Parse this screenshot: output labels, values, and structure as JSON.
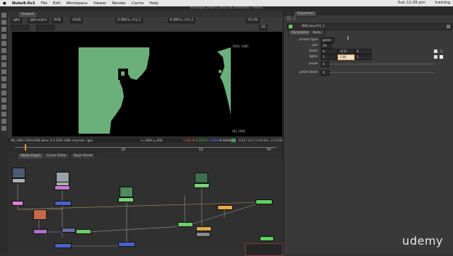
{
  "menubar": {
    "app_name": "Nuke9.0v1",
    "items": [
      "File",
      "Edit",
      "Workspace",
      "Viewer",
      "Render",
      "Cache",
      "Help"
    ],
    "clock": "Sun 11:05 pm",
    "user": "training"
  },
  "window_title": "telescope_shot01_v002.nk [modified] - NukeX",
  "viewer": {
    "tab_label": "Viewer1",
    "channels": "rgba",
    "alpha": "rgba.alpha",
    "display": "RGB",
    "colorspace": "sRGB",
    "input_a": "A  IBKCo..rV3_1",
    "input_b": "B  IBKCo..rV3_1",
    "zoom": "33.3%",
    "frame_field": "20",
    "format_tl": "1920, 1080",
    "format_br": "HD_1080",
    "info": "HD_1080 1920x1080  bbox: 0 0 1920 1080 channels: rgba",
    "coords": "x=1869 y=906",
    "pixel_r": "0.08539",
    "pixel_g": "0.29723",
    "pixel_b": "0.00000",
    "pixel_a": "0.00000",
    "hsvl": "H:127 S:0.73 V:0.30  L: 0.23762",
    "fps_label": "24*",
    "tf_label": "TF",
    "global_label": "Global",
    "frame_current": "1",
    "frame_end": "10",
    "ticks": [
      "10",
      "15",
      "50"
    ]
  },
  "node_graph": {
    "tabs": [
      "Node Graph",
      "Curve Editor",
      "Dope Sheet"
    ]
  },
  "properties": {
    "header_label": "Properties",
    "tabs": [
      "Parameters",
      "Node"
    ],
    "node_name": "IBKColourV3_1",
    "screen_type_label": "screen type",
    "screen_type_value": "green",
    "size_label": "size",
    "size_value": "10",
    "darks_label": "darks",
    "darks_values": [
      "0",
      "-0.11",
      "0"
    ],
    "lights_label": "lights",
    "lights_values": [
      "1",
      "1.08",
      "1"
    ],
    "erode_label": "erode",
    "erode_value": "0",
    "patch_black_label": "patch black",
    "patch_black_value": "0"
  },
  "watermark": "udemy"
}
